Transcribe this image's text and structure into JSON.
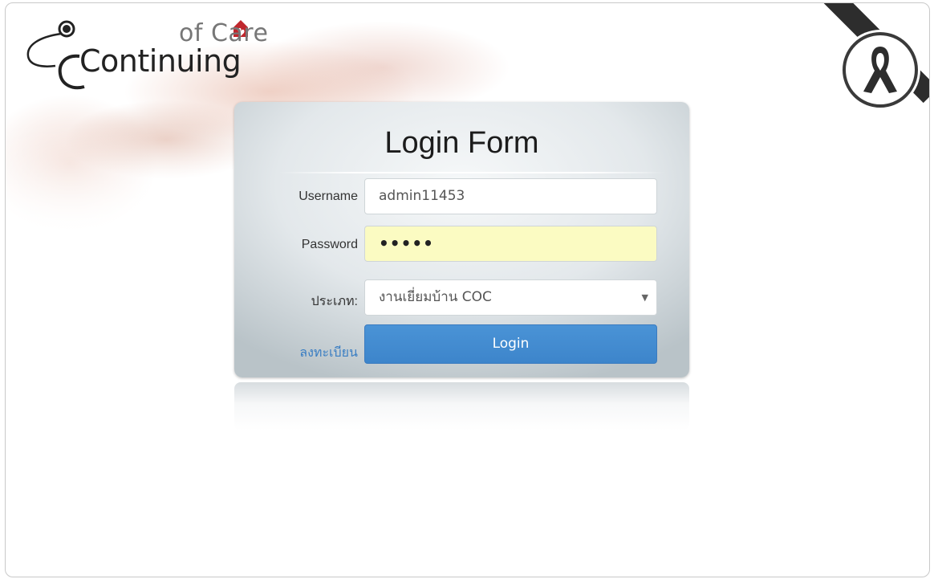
{
  "logo": {
    "top_text": "of Care",
    "main_text": "Continuing"
  },
  "login_form": {
    "title": "Login Form",
    "username_label": "Username",
    "username_value": "admin11453",
    "password_label": "Password",
    "password_mask": "•••••",
    "type_label": "ประเภท:",
    "type_selected": "งานเยี่ยมบ้าน COC",
    "register_link": "ลงทะเบียน",
    "login_button": "Login"
  },
  "colors": {
    "accent": "#3d85cb",
    "password_bg": "#fbfbc2",
    "link": "#3a7ec3",
    "logo_heart": "#c0272d"
  },
  "icons": {
    "ribbon": "mourning-ribbon-icon",
    "stethoscope": "stethoscope-icon"
  }
}
